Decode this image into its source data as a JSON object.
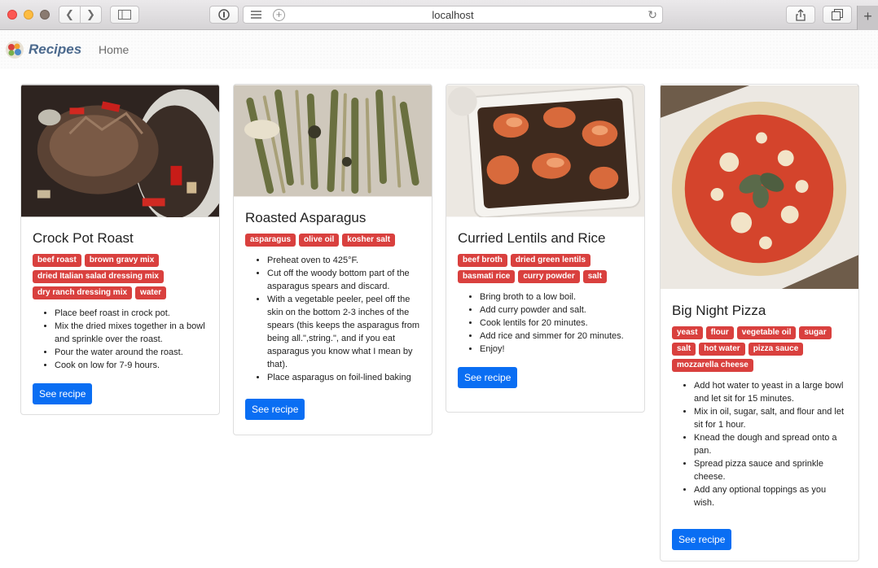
{
  "browser": {
    "url": "localhost"
  },
  "navbar": {
    "brand": "Recipes",
    "home_link": "Home"
  },
  "recipes": [
    {
      "title": "Crock Pot Roast",
      "ingredients": [
        "beef roast",
        "brown gravy mix",
        "dried Italian salad dressing mix",
        "dry ranch dressing mix",
        "water"
      ],
      "steps": [
        "Place beef roast in crock pot.",
        "Mix the dried mixes together in a bowl and sprinkle over the roast.",
        "Pour the water around the roast.",
        "Cook on low for 7-9 hours."
      ],
      "button": "See recipe"
    },
    {
      "title": "Roasted Asparagus",
      "ingredients": [
        "asparagus",
        "olive oil",
        "kosher salt"
      ],
      "steps": [
        "Preheat oven to 425°F.",
        "Cut off the woody bottom part of the asparagus spears and discard.",
        "With a vegetable peeler, peel off the skin on the bottom 2-3 inches of the spears (this keeps the asparagus from being all.\",string.\", and if you eat asparagus you know what I mean by that).",
        "Place asparagus on foil-lined baking"
      ],
      "button": "See recipe"
    },
    {
      "title": "Curried Lentils and Rice",
      "ingredients": [
        "beef broth",
        "dried green lentils",
        "basmati rice",
        "curry powder",
        "salt"
      ],
      "steps": [
        "Bring broth to a low boil.",
        "Add curry powder and salt.",
        "Cook lentils for 20 minutes.",
        "Add rice and simmer for 20 minutes.",
        "Enjoy!"
      ],
      "button": "See recipe"
    },
    {
      "title": "Big Night Pizza",
      "ingredients": [
        "yeast",
        "flour",
        "vegetable oil",
        "sugar",
        "salt",
        "hot water",
        "pizza sauce",
        "mozzarella cheese"
      ],
      "steps": [
        "Add hot water to yeast in a large bowl and let sit for 15 minutes.",
        "Mix in oil, sugar, salt, and flour and let sit for 1 hour.",
        "Knead the dough and spread onto a pan.",
        "Spread pizza sauce and sprinkle cheese.",
        "Add any optional toppings as you wish."
      ],
      "button": "See recipe"
    }
  ],
  "colors": {
    "tag": "#d9403e",
    "button": "#0a6ef3",
    "brand": "#4c6a8e"
  }
}
